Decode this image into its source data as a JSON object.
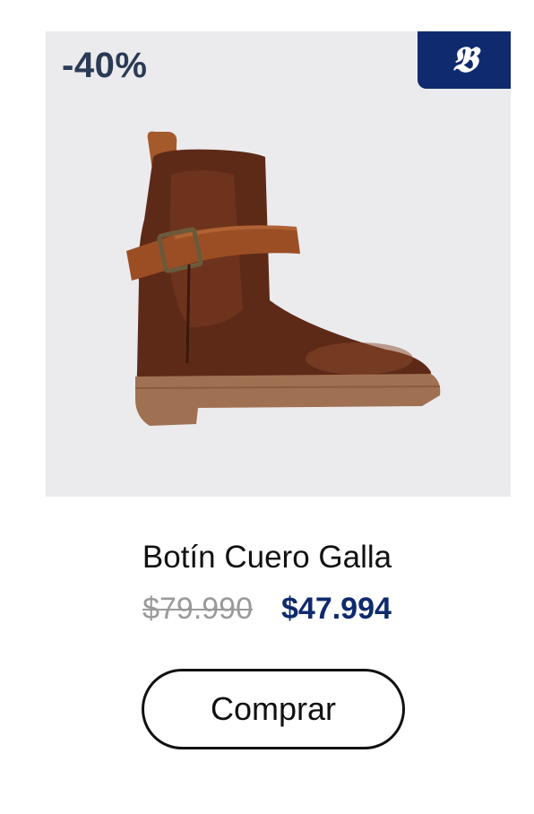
{
  "product": {
    "discount_badge": "-40%",
    "brand_logo_icon": "gothic-b-logo-icon",
    "image_icon": "brown-leather-ankle-boot-image",
    "title": "Botín Cuero Galla",
    "old_price": "$79.990",
    "new_price": "$47.994",
    "buy_label": "Comprar"
  },
  "colors": {
    "image_background": "#ebebed",
    "brand_navy": "#0f2a6e",
    "discount_text": "#2b3a55",
    "old_price": "#9a9a9a",
    "new_price": "#0f2a6e"
  }
}
